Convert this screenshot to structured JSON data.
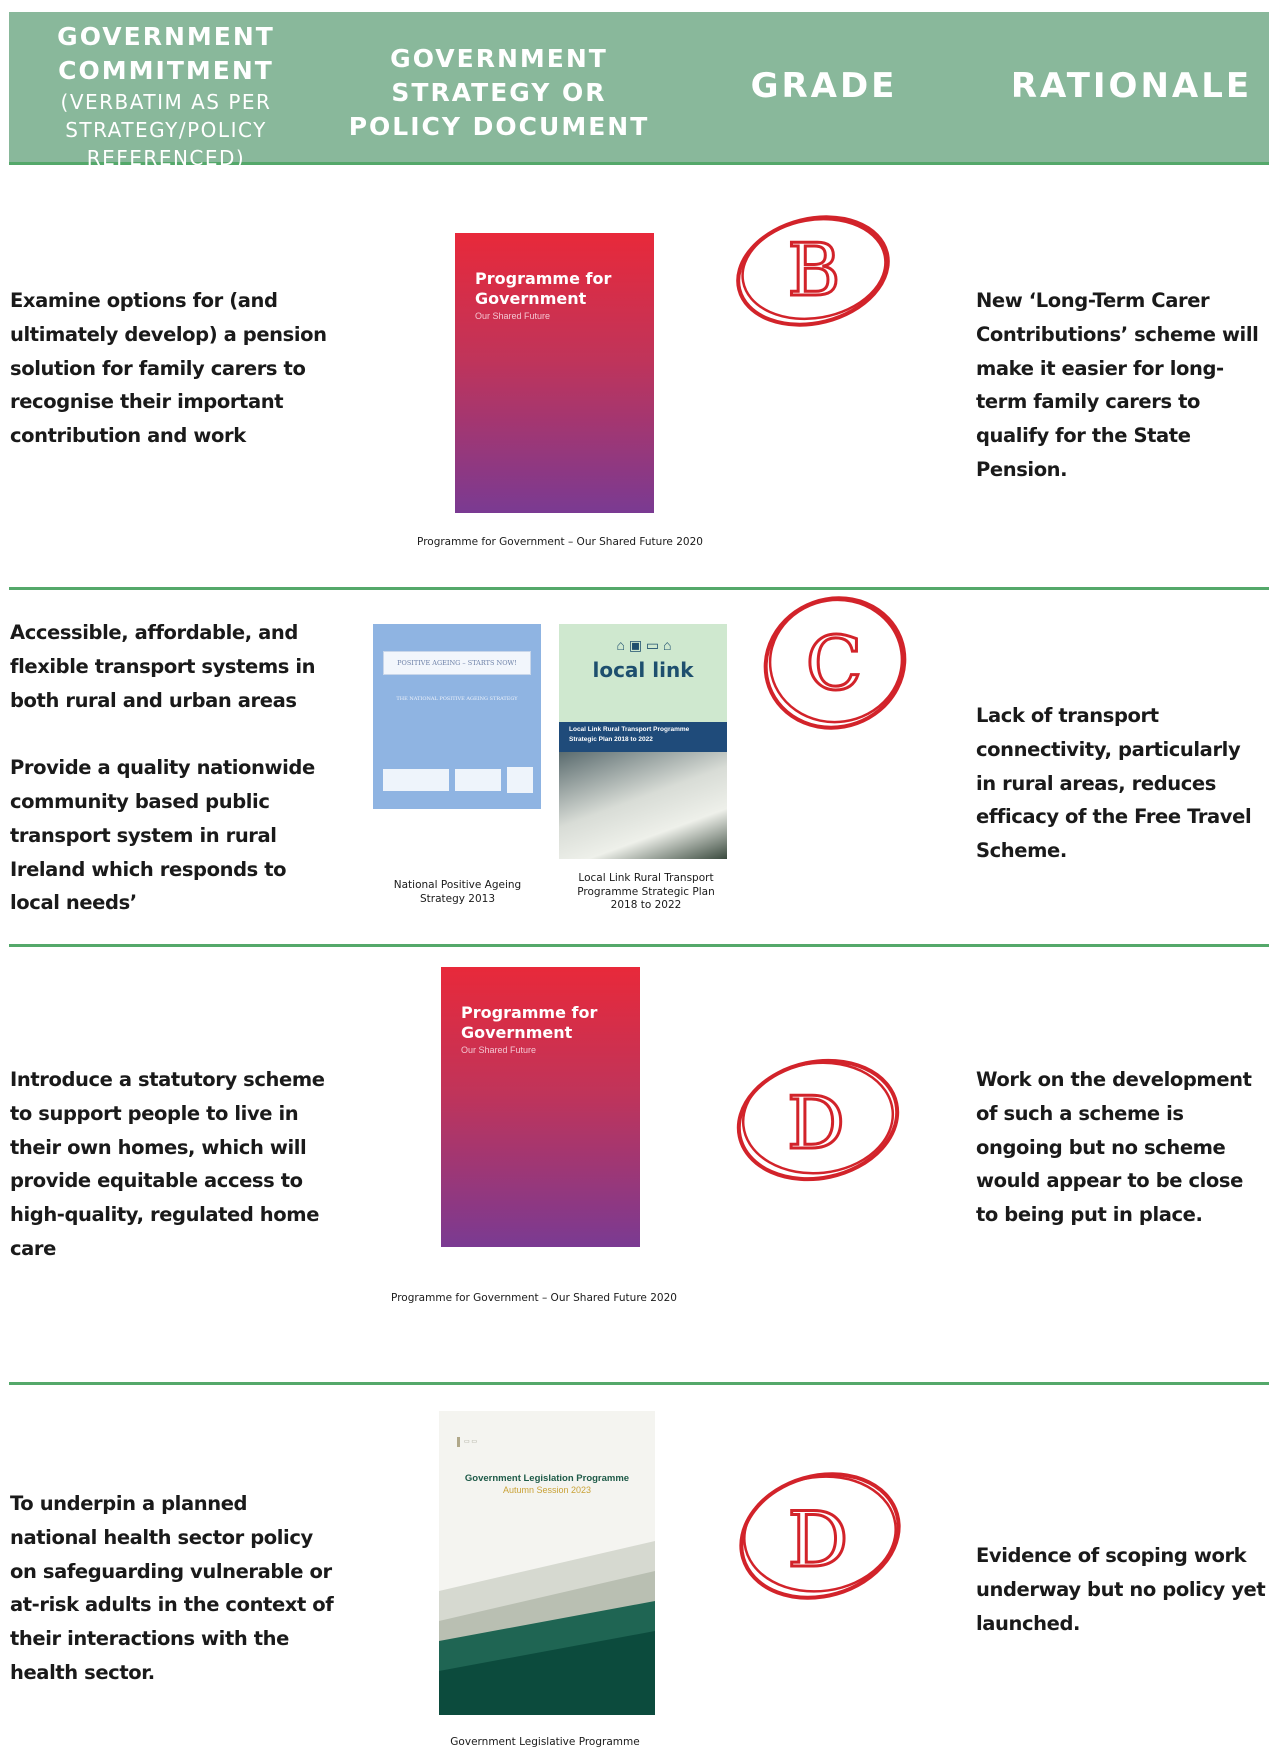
{
  "header": {
    "col1_title": "GOVERNMENT COMMITMENT",
    "col1_sub": "(VERBATIM AS PER STRATEGY/POLICY REFERENCED)",
    "col2_title": "GOVERNMENT STRATEGY OR POLICY DOCUMENT",
    "col3_title": "GRADE",
    "col4_title": "RATIONALE"
  },
  "rows": [
    {
      "commitment": "Examine options for (and ultimately develop) a pension solution for family carers to recognise their important contribution and work",
      "documents": [
        {
          "cover_title": "Programme for Government",
          "cover_sub": "Our Shared Future",
          "caption": "Programme for Government – Our Shared Future 2020"
        }
      ],
      "grade": "B",
      "rationale": "New ‘Long-Term Carer Contributions’ scheme will make it easier for long-term family carers to qualify for the State Pension."
    },
    {
      "commitment": "Accessible, affordable, and flexible transport systems in both rural and urban areas\n\nProvide a quality nationwide community based public transport system in rural Ireland which responds to local needs’",
      "documents": [
        {
          "cover_title": "POSITIVE AGEING – STARTS NOW!",
          "cover_sub": "THE NATIONAL POSITIVE AGEING STRATEGY",
          "caption": "National Positive Ageing Strategy 2013"
        },
        {
          "cover_title": "local link",
          "cover_sub": "Local Link Rural Transport Programme Strategic Plan 2018 to 2022",
          "caption": "Local Link Rural Transport Programme Strategic Plan 2018 to 2022"
        }
      ],
      "grade": "C",
      "rationale": "Lack of transport connectivity, particularly in rural areas, reduces efficacy of the Free Travel Scheme."
    },
    {
      "commitment": "Introduce a statutory scheme to support people to live in their own homes, which will provide equitable access to high-quality, regulated home care",
      "documents": [
        {
          "cover_title": "Programme for Government",
          "cover_sub": "Our Shared Future",
          "caption": "Programme for Government – Our Shared Future 2020"
        }
      ],
      "grade": "D",
      "rationale": "Work on the development of such a scheme is ongoing but no scheme would appear to be close to being put in place."
    },
    {
      "commitment": "To underpin a planned national health sector policy on safeguarding vulnerable or at-risk adults in the context of their interactions with the health sector.",
      "documents": [
        {
          "cover_title": "Government Legislation Programme",
          "cover_sub": "Autumn Session 2023",
          "caption": "Government Legislative Programme"
        }
      ],
      "grade": "D",
      "rationale": "Evidence of scoping work underway but no policy yet launched."
    }
  ],
  "colors": {
    "header_bg": "#89b89b",
    "divider": "#54a86a",
    "grade_ink": "#d2232a"
  }
}
